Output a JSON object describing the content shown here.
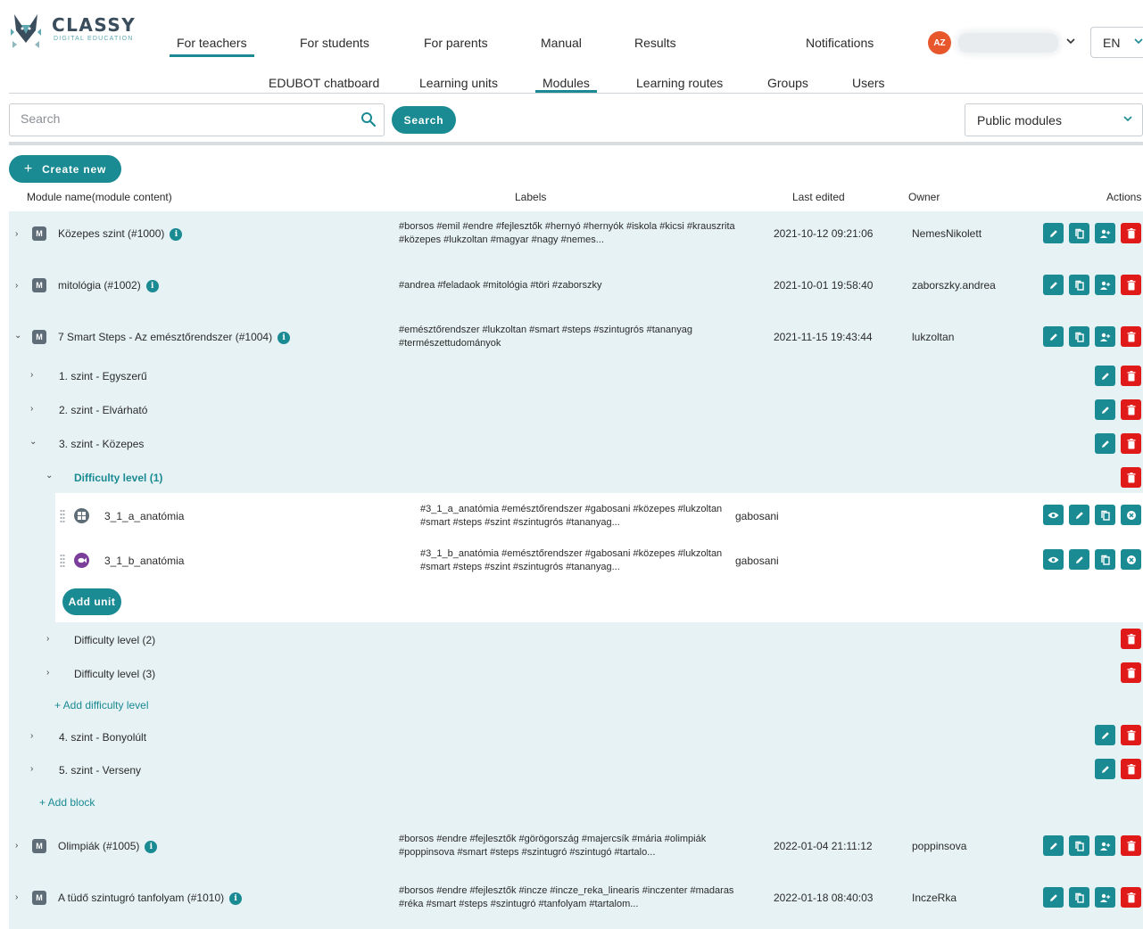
{
  "brand": {
    "name": "CLASSY",
    "tagline": "DIGITAL EDUCATION"
  },
  "topnav": [
    "For teachers",
    "For students",
    "For parents",
    "Manual",
    "Results",
    "Notifications"
  ],
  "user": {
    "initials": "AZ",
    "chevron": "⌄"
  },
  "language": {
    "value": "EN",
    "chevron": "⌄"
  },
  "subnav": [
    "EDUBOT chatboard",
    "Learning units",
    "Modules",
    "Learning routes",
    "Groups",
    "Users"
  ],
  "search": {
    "placeholder": "Search",
    "button": "Search"
  },
  "filter": {
    "value": "Public modules",
    "chevron": "⌄"
  },
  "create_button": "Create new",
  "columns": {
    "name": "Module name(module content)",
    "labels": "Labels",
    "last_edited": "Last edited",
    "owner": "Owner",
    "actions": "Actions"
  },
  "modules": [
    {
      "chevron": "›",
      "name": "Közepes szint (#1000)",
      "labels": "#borsos #emil #endre #fejlesztők #hernyó #hernyók #iskola #kicsi #krauszrita #közepes #lukzoltan #magyar #nagy #nemes...",
      "last_edited": "2021-10-12 09:21:06",
      "owner": "NemesNikolett"
    },
    {
      "chevron": "›",
      "name": "mitológia (#1002)",
      "labels": "#andrea #feladaok #mitológia #töri #zaborszky",
      "last_edited": "2021-10-01 19:58:40",
      "owner": "zaborszky.andrea"
    },
    {
      "chevron": "⌄",
      "name": "7 Smart Steps - Az emésztőrendszer (#1004)",
      "labels": "#emésztőrendszer #lukzoltan #smart #steps #szintugrós #tananyag #természettudományok",
      "last_edited": "2021-11-15 19:43:44",
      "owner": "lukzoltan"
    },
    {
      "chevron": "›",
      "name": "Olimpiák (#1005)",
      "labels": "#borsos #endre #fejlesztők #görögország #majercsík #mária #olimpiák #poppinsova #smart #steps #szintugró #szintugó #tartalo...",
      "last_edited": "2022-01-04 21:11:12",
      "owner": "poppinsova"
    },
    {
      "chevron": "›",
      "name": "A tüdő szintugró tanfolyam (#1010)",
      "labels": "#borsos #endre #fejlesztők #incze #incze_reka_linearis #inczenter #madaras #réka #smart #steps #szintugró #tanfolyam #tartalom...",
      "last_edited": "2022-01-18 08:40:03",
      "owner": "InczeRka"
    }
  ],
  "info_glyph": "i",
  "module_badge": "M",
  "blocks": [
    {
      "chevron": "›",
      "name": "1. szint - Egyszerű"
    },
    {
      "chevron": "›",
      "name": "2. szint - Elvárható"
    },
    {
      "chevron": "⌄",
      "name": "3. szint - Közepes"
    },
    {
      "chevron": "›",
      "name": "4. szint - Bonyolúlt"
    },
    {
      "chevron": "›",
      "name": "5. szint - Verseny"
    }
  ],
  "difficulty_levels": [
    {
      "chevron": "⌄",
      "name": "Difficulty level (1)"
    },
    {
      "chevron": "›",
      "name": "Difficulty level (2)"
    },
    {
      "chevron": "›",
      "name": "Difficulty level (3)"
    }
  ],
  "units": [
    {
      "name": "3_1_a_anatómia",
      "labels": "#3_1_a_anatómia #emésztőrendszer #gabosani #közepes #lukzoltan #smart #steps #szint #szintugrós #tananyag...",
      "owner": "gabosani",
      "icon": "puzzle-icon"
    },
    {
      "name": "3_1_b_anatómia",
      "labels": "#3_1_b_anatómia #emésztőrendszer #gabosani #közepes #lukzoltan #smart #steps #szint #szintugrós #tananyag...",
      "owner": "gabosani",
      "icon": "fish-icon"
    }
  ],
  "add_unit": "Add unit",
  "add_difficulty": "+ Add difficulty level",
  "add_block": "+ Add block",
  "colors": {
    "accent": "#1a8a93",
    "danger": "#e01919",
    "row_bg": "#e7f2f4",
    "avatar": "#e8572c"
  }
}
